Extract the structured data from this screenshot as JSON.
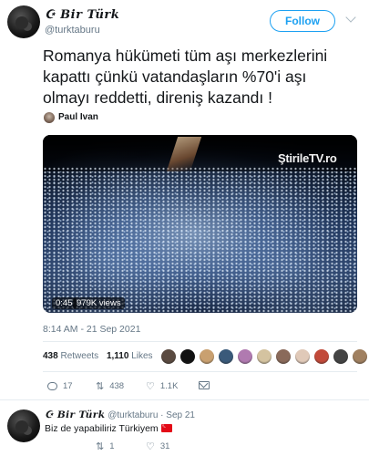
{
  "tweet": {
    "author": {
      "display_name": "☪ Bir Türk",
      "handle": "@turktaburu"
    },
    "follow_label": "Follow",
    "text": "Romanya hükümeti tüm aşı merkezlerini kapattı çünkü vatandaşların %70'i aşı olmayı reddetti, direniş kazandı !",
    "mention": "Paul Ivan",
    "media": {
      "watermark_prefix": "ŞtirileTV",
      "watermark_suffix": ".ro",
      "duration": "0:45",
      "views": "979K views"
    },
    "timestamp": "8:14 AM - 21 Sep 2021",
    "stats": {
      "retweets_count": "438",
      "retweets_label": "Retweets",
      "likes_count": "1,110",
      "likes_label": "Likes"
    },
    "liker_colors": [
      "#5a4a40",
      "#111111",
      "#c9a070",
      "#3a5a7a",
      "#b07ab0",
      "#d4c3a0",
      "#8a6a5a",
      "#e0c9b8",
      "#c24a3a",
      "#444444",
      "#a08060"
    ],
    "actions": {
      "replies": "17",
      "retweets": "438",
      "likes": "1.1K"
    }
  },
  "reply": {
    "display_name": "☪ Bir Türk",
    "handle": "@turktaburu",
    "time": "· Sep 21",
    "text": "Biz de yapabiliriz Türkiyem",
    "actions": {
      "retweets": "1",
      "likes": "31"
    }
  }
}
